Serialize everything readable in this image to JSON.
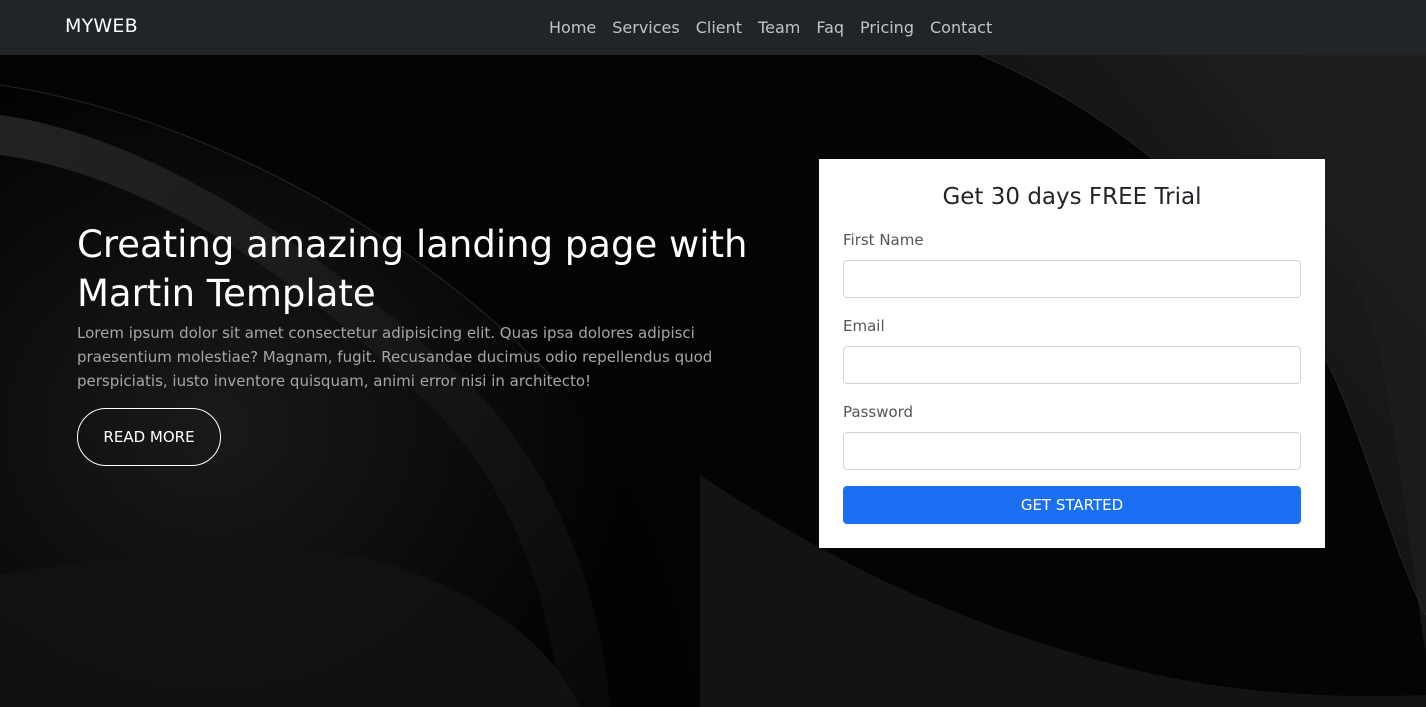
{
  "navbar": {
    "brand": "MYWEB",
    "links": [
      "Home",
      "Services",
      "Client",
      "Team",
      "Faq",
      "Pricing",
      "Contact"
    ]
  },
  "hero": {
    "title": "Creating amazing landing page with Martin Template",
    "text": "Lorem ipsum dolor sit amet consectetur adipisicing elit. Quas ipsa dolores adipisci praesentium molestiae? Magnam, fugit. Recusandae ducimus odio repellendus quod perspiciatis, iusto inventore quisquam, animi error nisi in architecto!",
    "button_label": "READ MORE"
  },
  "form": {
    "title": "Get 30 days FREE Trial",
    "fields": [
      {
        "label": "First Name",
        "value": ""
      },
      {
        "label": "Email",
        "value": ""
      },
      {
        "label": "Password",
        "value": ""
      }
    ],
    "submit_label": "GET STARTED"
  },
  "colors": {
    "navbar": "#212529",
    "primary_button": "#1a6ff2",
    "hero_background": "#050505"
  }
}
